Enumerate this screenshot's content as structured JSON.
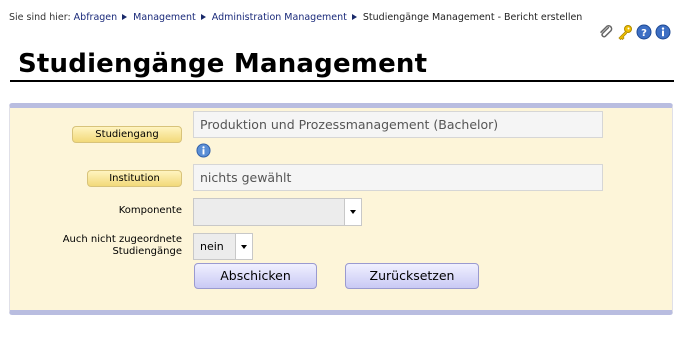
{
  "breadcrumb": {
    "prefix": "Sie sind hier:",
    "items": [
      "Abfragen",
      "Management",
      "Administration Management"
    ],
    "current": "Studiengänge Management - Bericht erstellen"
  },
  "toolbar_icons": [
    "paperclip-icon",
    "key-icon",
    "help-icon",
    "info-icon"
  ],
  "page": {
    "title": "Studiengänge Management"
  },
  "form": {
    "studiengang": {
      "label": "Studiengang",
      "value": "Produktion und Prozessmanagement (Bachelor)"
    },
    "institution": {
      "label": "Institution",
      "value": "nichts gewählt"
    },
    "komponente": {
      "label": "Komponente",
      "value": ""
    },
    "nicht_zugeordnet": {
      "label_line1": "Auch nicht zugeordnete",
      "label_line2": "Studiengänge",
      "value": "nein"
    },
    "submit_label": "Abschicken",
    "reset_label": "Zurücksetzen"
  },
  "colors": {
    "panel_bg": "#fdf5d9",
    "panel_border": "#b9bde0",
    "label_button": "#f2d97a",
    "action_button": "#c9c9f4",
    "link": "#1a2a7a"
  }
}
